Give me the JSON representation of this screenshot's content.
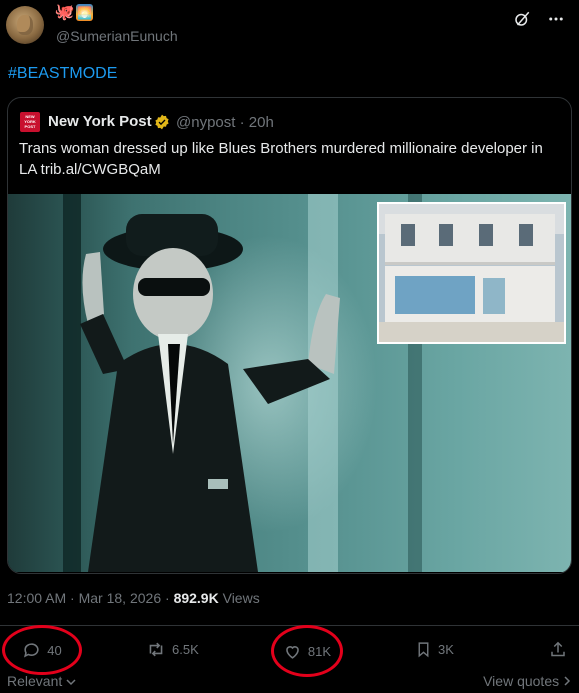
{
  "author": {
    "handle": "@SumerianEunuch",
    "emoji": [
      "🐙",
      "🌅"
    ]
  },
  "post": {
    "text": "#BEASTMODE"
  },
  "quoted": {
    "name": "New York Post",
    "logo_text": "NEW YORK POST",
    "handle": "@nypost",
    "sep": "·",
    "age": "20h",
    "text": "Trans woman dressed up like Blues Brothers murdered millionaire developer in LA trib.al/CWGBQaM"
  },
  "meta": {
    "time": "12:00 AM",
    "date": "Mar 18, 2026",
    "views_count": "892.9K",
    "views_label": "Views",
    "sep": "·"
  },
  "actions": {
    "replies": "40",
    "reposts": "6.5K",
    "likes": "81K",
    "bookmarks": "3K"
  },
  "footer": {
    "sort": "Relevant",
    "view_quotes": "View quotes"
  },
  "colors": {
    "accent": "#1d9bf0",
    "annotation": "#e3001b",
    "bg": "#000000"
  }
}
